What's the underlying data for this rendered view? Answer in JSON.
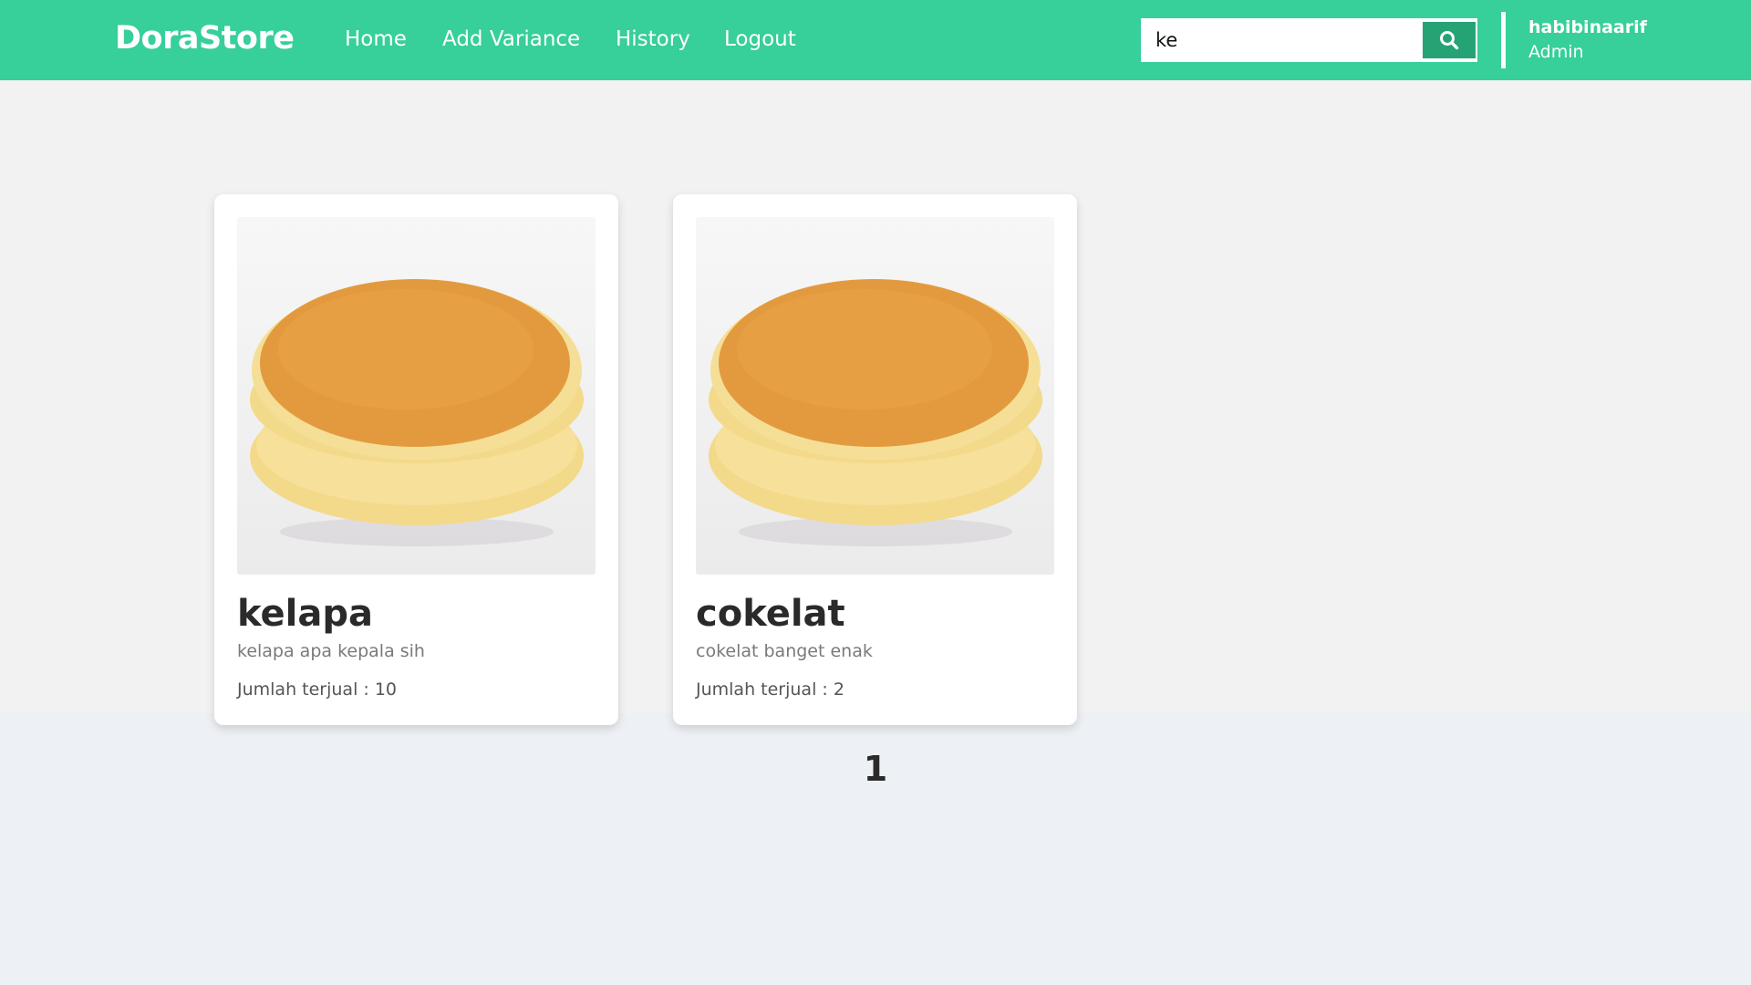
{
  "nav": {
    "brand": "DoraStore",
    "links": [
      "Home",
      "Add Variance",
      "History",
      "Logout"
    ]
  },
  "search": {
    "value": "ke",
    "placeholder": "",
    "button_icon": "search-icon"
  },
  "user": {
    "name": "habibinaarif",
    "role": "Admin"
  },
  "products": [
    {
      "name": "kelapa",
      "description": "kelapa apa kepala sih",
      "sold": "Jumlah terjual : 10"
    },
    {
      "name": "cokelat",
      "description": "cokelat banget enak",
      "sold": "Jumlah terjual : 2"
    }
  ],
  "pagination": {
    "current": "1"
  },
  "colors": {
    "navbar": "#37cf9a",
    "search_button": "#25a374",
    "content_bg": "#f2f2f2",
    "page_bg": "#edf0f4"
  }
}
